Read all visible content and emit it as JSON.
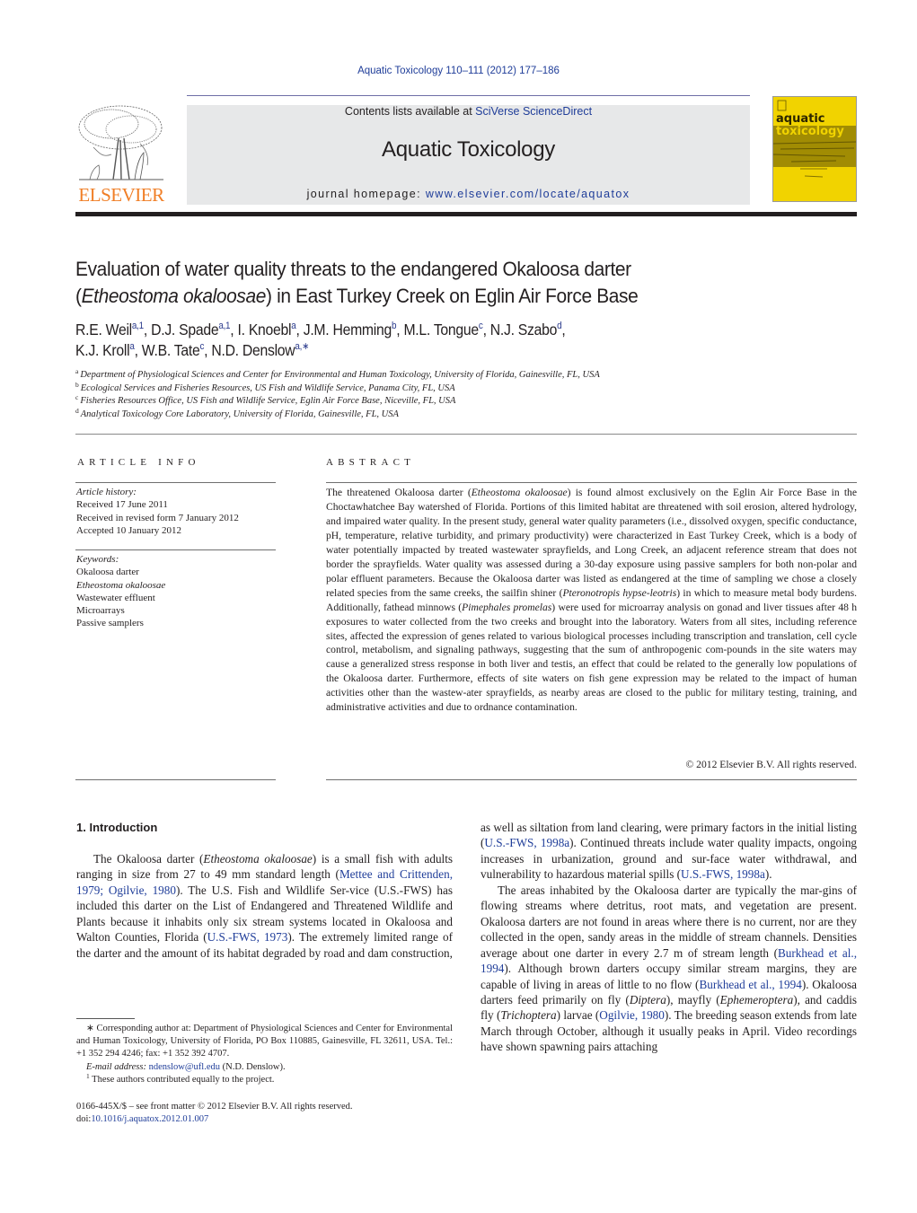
{
  "header": {
    "journal_ref": "Aquatic Toxicology 110–111 (2012) 177–186",
    "contents_prefix": "Contents lists available at ",
    "contents_link": "SciVerse ScienceDirect",
    "journal_name": "Aquatic Toxicology",
    "homepage_prefix": "journal homepage: ",
    "homepage_link": "www.elsevier.com/locate/aquatox",
    "publisher_logo_text": "ELSEVIER",
    "cover_title_1": "aquatic",
    "cover_title_2": "toxicology"
  },
  "article": {
    "title_line1": "Evaluation of water quality threats to the endangered Okaloosa darter",
    "title_italic": "Etheostoma okaloosae",
    "title_line2_rest": ") in East Turkey Creek on Eglin Air Force Base",
    "authors": [
      {
        "name": "R.E. Weil",
        "sup": "a,1"
      },
      {
        "name": "D.J. Spade",
        "sup": "a,1"
      },
      {
        "name": "I. Knoebl",
        "sup": "a"
      },
      {
        "name": "J.M. Hemming",
        "sup": "b"
      },
      {
        "name": "M.L. Tongue",
        "sup": "c"
      },
      {
        "name": "N.J. Szabo",
        "sup": "d"
      },
      {
        "name": "K.J. Kroll",
        "sup": "a"
      },
      {
        "name": "W.B. Tate",
        "sup": "c"
      },
      {
        "name": "N.D. Denslow",
        "sup": "a,∗"
      }
    ],
    "affiliations": [
      {
        "key": "a",
        "text": "Department of Physiological Sciences and Center for Environmental and Human Toxicology, University of Florida, Gainesville, FL, USA"
      },
      {
        "key": "b",
        "text": "Ecological Services and Fisheries Resources, US Fish and Wildlife Service, Panama City, FL, USA"
      },
      {
        "key": "c",
        "text": "Fisheries Resources Office, US Fish and Wildlife Service, Eglin Air Force Base, Niceville, FL, USA"
      },
      {
        "key": "d",
        "text": "Analytical Toxicology Core Laboratory, University of Florida, Gainesville, FL, USA"
      }
    ]
  },
  "article_info": {
    "label": "ARTICLE INFO",
    "history_header": "Article history:",
    "history": [
      "Received 17 June 2011",
      "Received in revised form 7 January 2012",
      "Accepted 10 January 2012"
    ],
    "keywords_header": "Keywords:",
    "keywords": [
      "Okaloosa darter",
      "Etheostoma okaloosae",
      "Wastewater effluent",
      "Microarrays",
      "Passive samplers"
    ]
  },
  "abstract": {
    "label": "ABSTRACT",
    "p1": "The threatened Okaloosa darter (",
    "i1": "Etheostoma okaloosae",
    "p2": ") is found almost exclusively on the Eglin Air Force Base in the Choctawhatchee Bay watershed of Florida. Portions of this limited habitat are threatened with soil erosion, altered hydrology, and impaired water quality. In the present study, general water quality parameters (i.e., dissolved oxygen, specific conductance, pH, temperature, relative turbidity, and primary productivity) were characterized in East Turkey Creek, which is a body of water potentially impacted by treated wastewater sprayfields, and Long Creek, an adjacent reference stream that does not border the sprayfields. Water quality was assessed during a 30-day exposure using passive samplers for both non-polar and polar effluent parameters. Because the Okaloosa darter was listed as endangered at the time of sampling we chose a closely related species from the same creeks, the sailfin shiner (",
    "i2": "Pteronotropis hypse-leotris",
    "p3": ") in which to measure metal body burdens. Additionally, fathead minnows (",
    "i3": "Pimephales promelas",
    "p4": ") were used for microarray analysis on gonad and liver tissues after 48 h exposures to water collected from the two creeks and brought into the laboratory. Waters from all sites, including reference sites, affected the expression of genes related to various biological processes including transcription and translation, cell cycle control, metabolism, and signaling pathways, suggesting that the sum of anthropogenic com-pounds in the site waters may cause a generalized stress response in both liver and testis, an effect that could be related to the generally low populations of the Okaloosa darter. Furthermore, effects of site waters on fish gene expression may be related to the impact of human activities other than the wastew-ater sprayfields, as nearby areas are closed to the public for military testing, training, and administrative activities and due to ordnance contamination.",
    "copyright": "© 2012 Elsevier B.V. All rights reserved."
  },
  "introduction": {
    "heading": "1.  Introduction",
    "col1": {
      "t1": "The Okaloosa darter (",
      "i1": "Etheostoma okaloosae",
      "t2": ") is a small fish with adults ranging in size from 27 to 49 mm standard length (",
      "c1": "Mettee and Crittenden, 1979; Ogilvie, 1980",
      "t3": "). The U.S. Fish and Wildlife Ser-vice (U.S.-FWS) has included this darter on the List of Endangered and Threatened Wildlife and Plants because it inhabits only six stream systems located in Okaloosa and Walton Counties, Florida (",
      "c2": "U.S.-FWS, 1973",
      "t4": "). The extremely limited range of the darter and the amount of its habitat degraded by road and dam construction,"
    },
    "col2": {
      "t1": "as well as siltation from land clearing, were primary factors in the initial listing (",
      "c1": "U.S.-FWS, 1998a",
      "t2": "). Continued threats include water quality impacts, ongoing increases in urbanization, ground and sur-face water withdrawal, and vulnerability to hazardous material spills (",
      "c2": "U.S.-FWS, 1998a",
      "t3": ").",
      "p2_t1": "The areas inhabited by the Okaloosa darter are typically the mar-gins of flowing streams where detritus, root mats, and vegetation are present. Okaloosa darters are not found in areas where there is no current, nor are they collected in the open, sandy areas in the middle of stream channels. Densities average about one darter in every 2.7 m of stream length (",
      "p2_c1": "Burkhead et al., 1994",
      "p2_t2": "). Although brown darters occupy similar stream margins, they are capable of living in areas of little to no flow (",
      "p2_c2": "Burkhead et al., 1994",
      "p2_t3": "). Okaloosa darters feed primarily on fly (",
      "p2_i1": "Diptera",
      "p2_t4": "), mayfly (",
      "p2_i2": "Ephemeroptera",
      "p2_t5": "), and caddis fly (",
      "p2_i3": "Trichoptera",
      "p2_t6": ") larvae (",
      "p2_c3": "Ogilvie, 1980",
      "p2_t7": "). The breeding season extends from late March through October, although it usually peaks in April. Video recordings have shown spawning pairs attaching"
    }
  },
  "footnotes": {
    "corresponding": "∗ Corresponding author at: Department of Physiological Sciences and Center for Environmental and Human Toxicology, University of Florida, PO Box 110885, Gainesville, FL 32611, USA. Tel.: +1 352 294 4246; fax: +1 352 392 4707.",
    "email_label": "E-mail address: ",
    "email": "ndenslow@ufl.edu",
    "email_suffix": " (N.D. Denslow).",
    "equal_sup": "1",
    "equal_text": " These authors contributed equally to the project."
  },
  "front_matter": {
    "issn_line": "0166-445X/$ – see front matter © 2012 Elsevier B.V. All rights reserved.",
    "doi_prefix": "doi:",
    "doi": "10.1016/j.aquatox.2012.01.007"
  },
  "colors": {
    "link": "#1f3d99",
    "elsevier_orange": "#f07e26",
    "cover_yellow": "#f1d300",
    "masthead_gray": "#e7e8e9"
  }
}
